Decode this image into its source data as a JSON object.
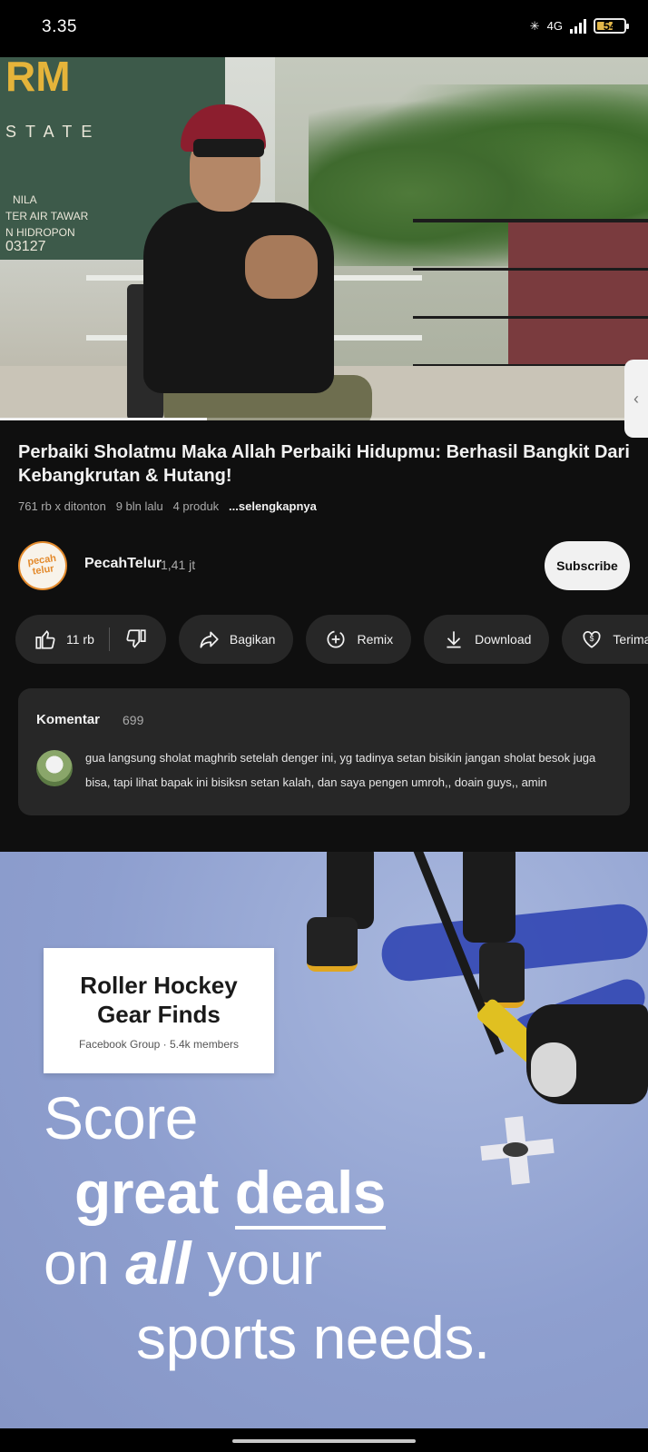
{
  "status_bar": {
    "time": "3.35",
    "network": "4G",
    "battery_level": "54",
    "battery_fraction": 0.54
  },
  "video": {
    "banner_lines": [
      "RM",
      "STATE",
      "NILA",
      "TER AIR TAWAR",
      "N HIDROPON",
      "03127"
    ],
    "progress_fraction": 0.32
  },
  "info": {
    "title": "Perbaiki Sholatmu Maka Allah Perbaiki Hidupmu: Berhasil Bangkit Dari Kebangkrutan & Hutang!",
    "views": "761 rb x ditonton",
    "age": "9 bln lalu",
    "products": "4 produk",
    "more": "...selengkapnya"
  },
  "channel": {
    "name": "PecahTelur",
    "subscribers": "1,41 jt",
    "avatar_text": "pecah telur",
    "subscribe_label": "Subscribe"
  },
  "actions": {
    "like_count": "11 rb",
    "share": "Bagikan",
    "remix": "Remix",
    "download": "Download",
    "thanks": "Terima kasih"
  },
  "comments": {
    "label": "Komentar",
    "count": "699",
    "top_comment": "gua langsung sholat maghrib setelah denger ini, yg tadinya setan bisikin jangan sholat besok juga bisa, tapi lihat bapak ini bisiksn setan kalah, dan saya pengen umroh,, doain guys,, amin"
  },
  "ad": {
    "card_title": "Roller Hockey Gear Finds",
    "card_subtitle": "Facebook Group · 5.4k members",
    "line1": "Score",
    "line2_a": "great",
    "line2_b": "deals",
    "line3_a": "on",
    "line3_b": "all",
    "line3_c": "your",
    "line4": "sports needs."
  },
  "colors": {
    "background": "#0f0f0f",
    "pill": "#272727",
    "subscribe_bg": "#f1f1f1",
    "avatar_accent": "#e38a2c"
  },
  "icons": [
    "bluetooth-icon",
    "signal-icon",
    "battery-icon",
    "like-icon",
    "dislike-icon",
    "share-icon",
    "remix-icon",
    "download-icon",
    "thanks-icon",
    "chevron-left-icon"
  ]
}
